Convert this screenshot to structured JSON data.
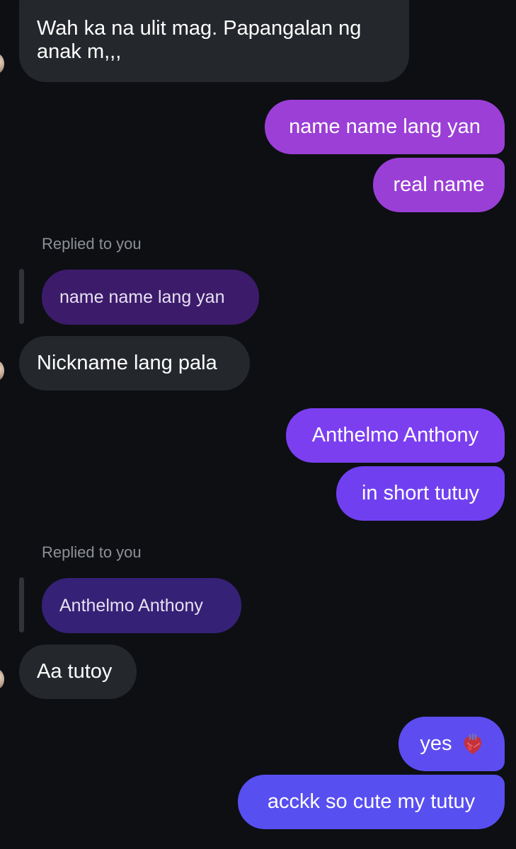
{
  "messages": {
    "m1": "Wah ka na ulit mag. Papangalan ng",
    "m1_line2": "anak m,,,",
    "m2": "name name lang yan",
    "m3": "real name",
    "reply1_label": "Replied to you",
    "reply1_quote": "name name lang yan",
    "m4": "Nickname lang pala",
    "m5": "Anthelmo Anthony",
    "m6": "in short tutuy",
    "reply2_label": "Replied to you",
    "reply2_quote": "Anthelmo Anthony",
    "m7": "Aa tutoy",
    "m8": "yes",
    "m9": "acckk so cute my tutuy"
  },
  "icons": {
    "m8_emoji": "anatomical-heart-icon"
  },
  "colors": {
    "background": "#0d0f13",
    "incoming_bubble": "#24272c",
    "outgoing_purple_top": "#9b3fd6",
    "outgoing_violet_mid": "#7a3ef0",
    "outgoing_indigo_bottom": "#5b4ff0",
    "quoted_bubble_1": "#3d1b6b",
    "quoted_bubble_2": "#352176",
    "meta_text": "#8d9097"
  }
}
